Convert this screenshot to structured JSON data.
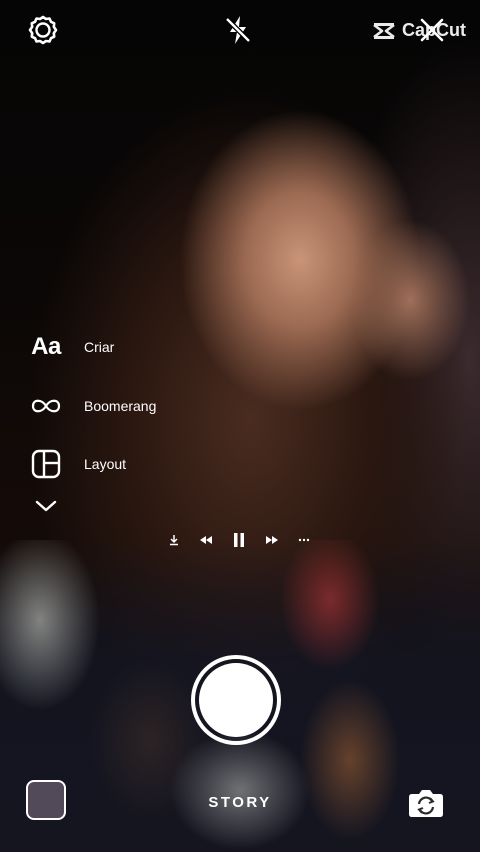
{
  "top_bar": {
    "settings_icon": "gear-icon",
    "flash_icon": "flash-off-icon",
    "close_icon": "close-icon"
  },
  "watermark": {
    "text": "CapCut"
  },
  "modes": [
    {
      "icon": "text-aa-icon",
      "icon_text": "Aa",
      "label": "Criar"
    },
    {
      "icon": "infinity-icon",
      "label": "Boomerang"
    },
    {
      "icon": "layout-grid-icon",
      "label": "Layout"
    }
  ],
  "more_modes_icon": "chevron-down-icon",
  "media_controls": [
    "download-icon",
    "rewind-icon",
    "pause-icon",
    "fast-forward-icon",
    "more-dots-icon"
  ],
  "bottom_bar": {
    "mode_label": "STORY",
    "gallery_icon": "gallery-thumbnail",
    "flip_icon": "camera-flip-icon"
  }
}
